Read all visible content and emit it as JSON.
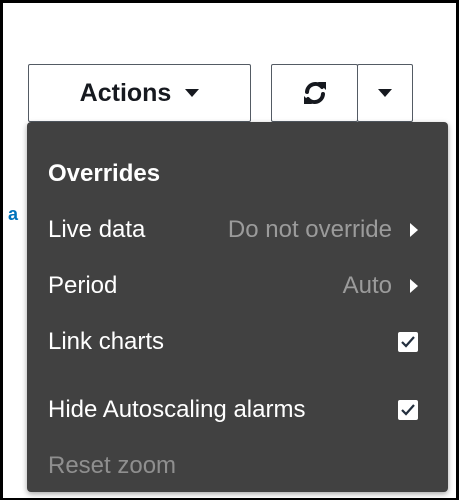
{
  "background": {
    "link_fragment": "a"
  },
  "toolbar": {
    "actions_label": "Actions"
  },
  "menu": {
    "section_title": "Overrides",
    "items": [
      {
        "label": "Live data",
        "value": "Do not override",
        "type": "submenu"
      },
      {
        "label": "Period",
        "value": "Auto",
        "type": "submenu"
      },
      {
        "label": "Link charts",
        "checked": true,
        "type": "checkbox"
      },
      {
        "label": "Hide Autoscaling alarms",
        "checked": true,
        "type": "checkbox"
      },
      {
        "label": "Reset zoom",
        "disabled": true,
        "type": "action"
      }
    ]
  },
  "colors": {
    "menu_bg": "#414141",
    "link": "#0073bb",
    "disabled_text": "#8f8f8f",
    "muted_value": "#9b9b9b"
  },
  "icons": {
    "refresh": "refresh-icon",
    "caret": "caret-down-icon",
    "submenu": "caret-right-icon",
    "check": "checkmark-icon"
  }
}
